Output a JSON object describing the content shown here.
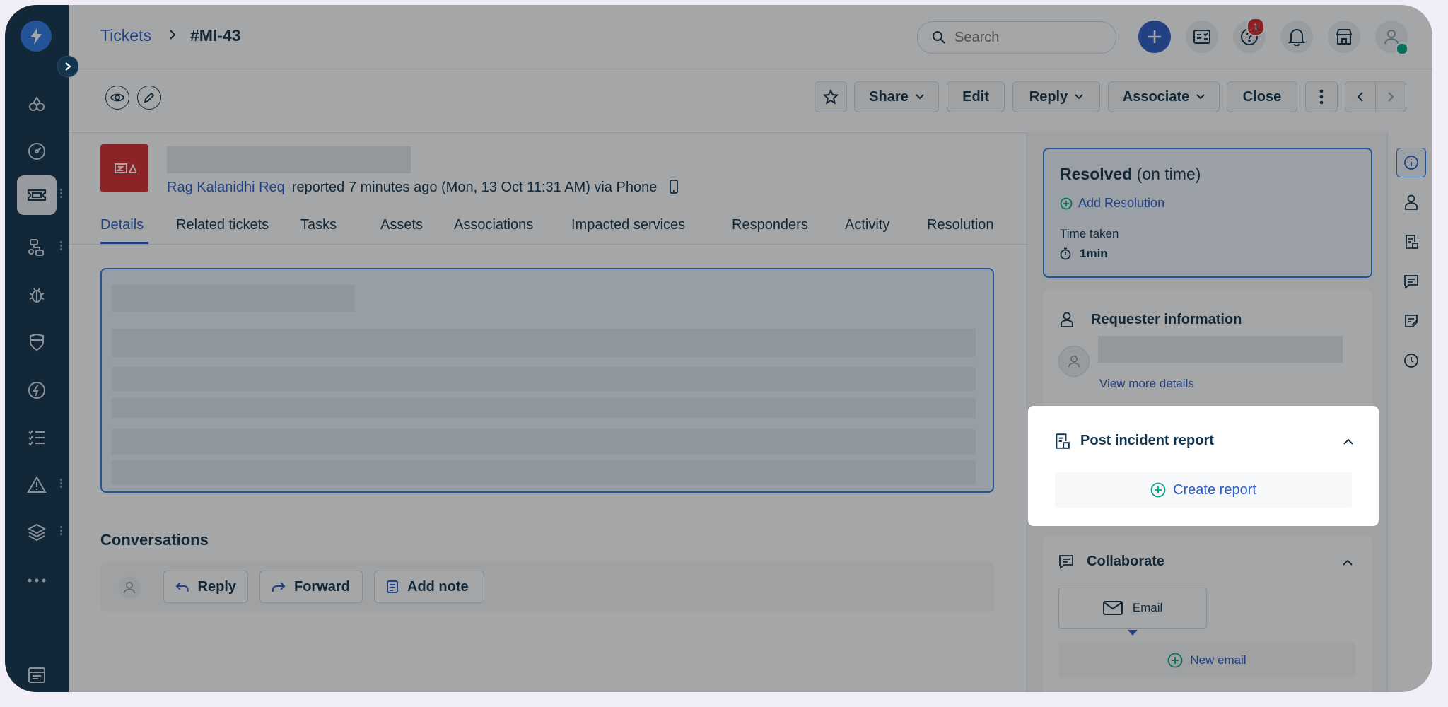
{
  "breadcrumb": {
    "parent": "Tickets",
    "current": "#MI-43"
  },
  "search": {
    "placeholder": "Search"
  },
  "notifications": {
    "help_badge": "1"
  },
  "toolbar": {
    "share": "Share",
    "edit": "Edit",
    "reply": "Reply",
    "associate": "Associate",
    "close": "Close"
  },
  "ticket": {
    "requester": "Rag Kalanidhi Req",
    "meta": "reported 7 minutes ago (Mon, 13 Oct 11:31 AM) via Phone"
  },
  "tabs": [
    "Details",
    "Related tickets",
    "Tasks",
    "Assets",
    "Associations",
    "Impacted services",
    "Responders",
    "Activity",
    "Resolution"
  ],
  "conversations": {
    "title": "Conversations",
    "reply": "Reply",
    "forward": "Forward",
    "add_note": "Add note"
  },
  "status_card": {
    "status": "Resolved",
    "qualifier": "(on time)",
    "add_resolution": "Add Resolution",
    "time_taken_label": "Time taken",
    "time_taken_value": "1min"
  },
  "requester_card": {
    "title": "Requester information",
    "view_more": "View more details"
  },
  "post_incident": {
    "title": "Post incident report",
    "create": "Create report"
  },
  "collaborate": {
    "title": "Collaborate",
    "email": "Email",
    "new_email": "New email"
  },
  "colors": {
    "nav_bg": "#12344d",
    "accent": "#2c5cc5",
    "danger": "#d72d30",
    "success": "#00a886"
  }
}
